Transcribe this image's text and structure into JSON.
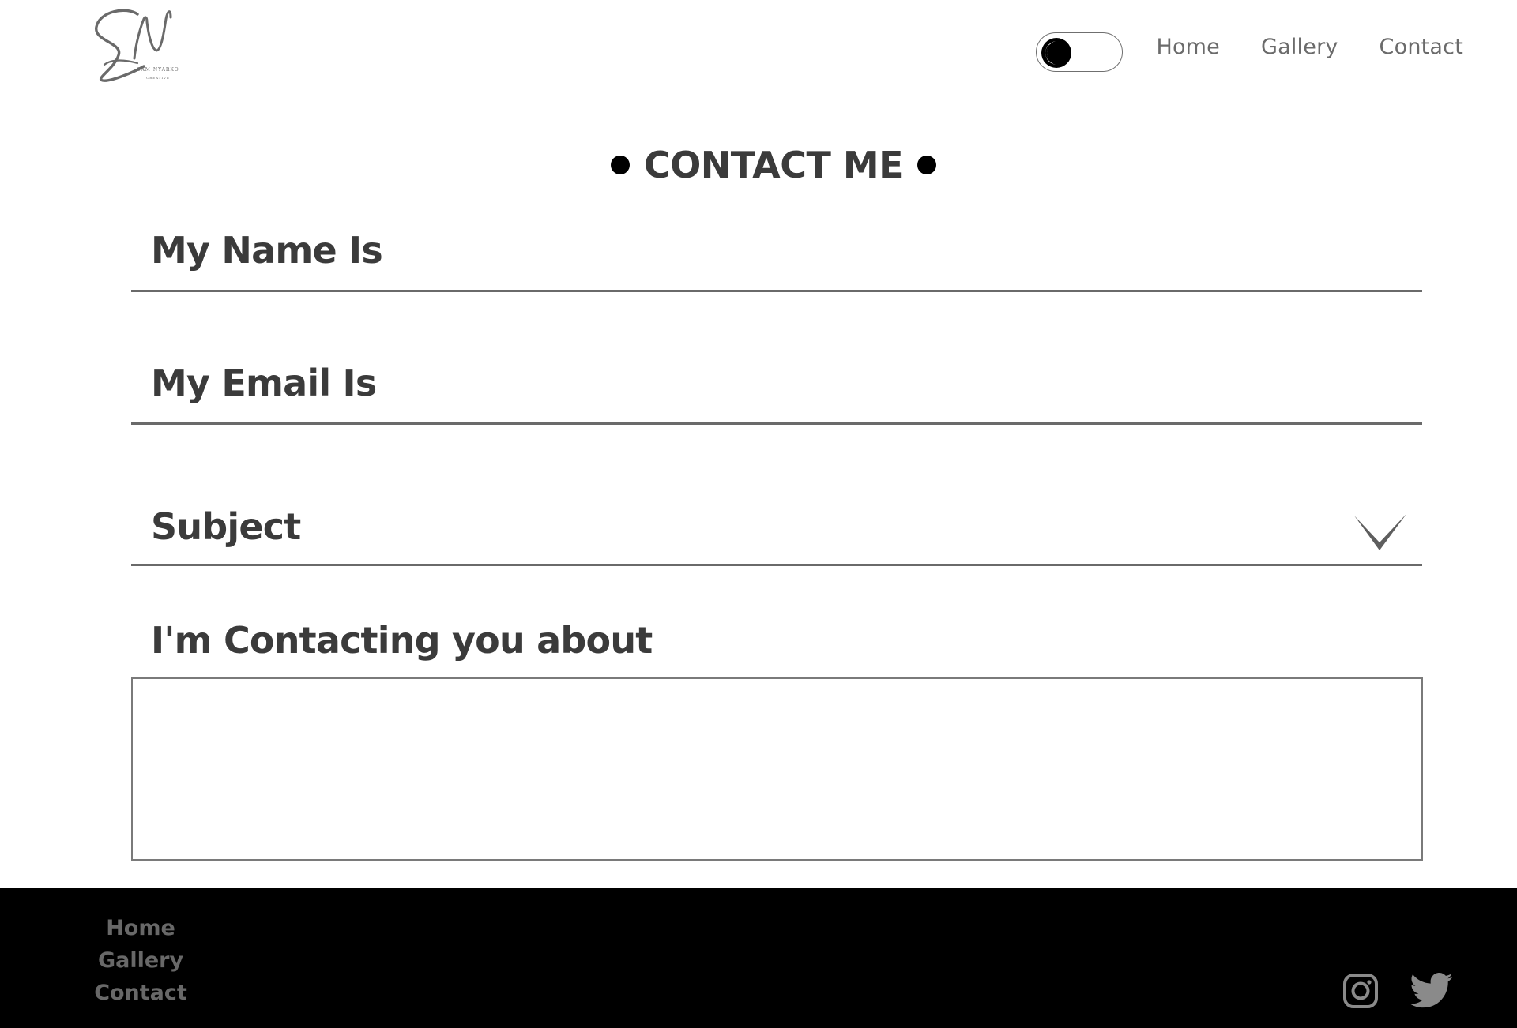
{
  "header": {
    "logo_text": "SN",
    "logo_subtitle": "SAM NYARKO",
    "logo_tagline": "CREATIVE",
    "theme_toggle": {
      "state": "dark-mode-off",
      "icon": "moon-icon"
    },
    "nav": [
      {
        "label": "Home"
      },
      {
        "label": "Gallery"
      },
      {
        "label": "Contact"
      }
    ]
  },
  "main": {
    "title": "CONTACT ME",
    "form": {
      "name_label": "My Name Is",
      "email_label": "My Email Is",
      "subject_label": "Subject",
      "subject_icon": "chevron-down-icon",
      "message_label": "I'm Contacting you about",
      "message_value": ""
    }
  },
  "footer": {
    "nav": [
      {
        "label": "Home"
      },
      {
        "label": "Gallery"
      },
      {
        "label": "Contact"
      }
    ],
    "social": [
      {
        "icon": "instagram-icon"
      },
      {
        "icon": "twitter-icon"
      }
    ]
  },
  "colors": {
    "background": "#ffffff",
    "text": "#3b3b3b",
    "nav_text": "#6b6b6b",
    "footer_bg": "#000000",
    "footer_text": "#686868",
    "social_icon": "#8a8a8a"
  }
}
